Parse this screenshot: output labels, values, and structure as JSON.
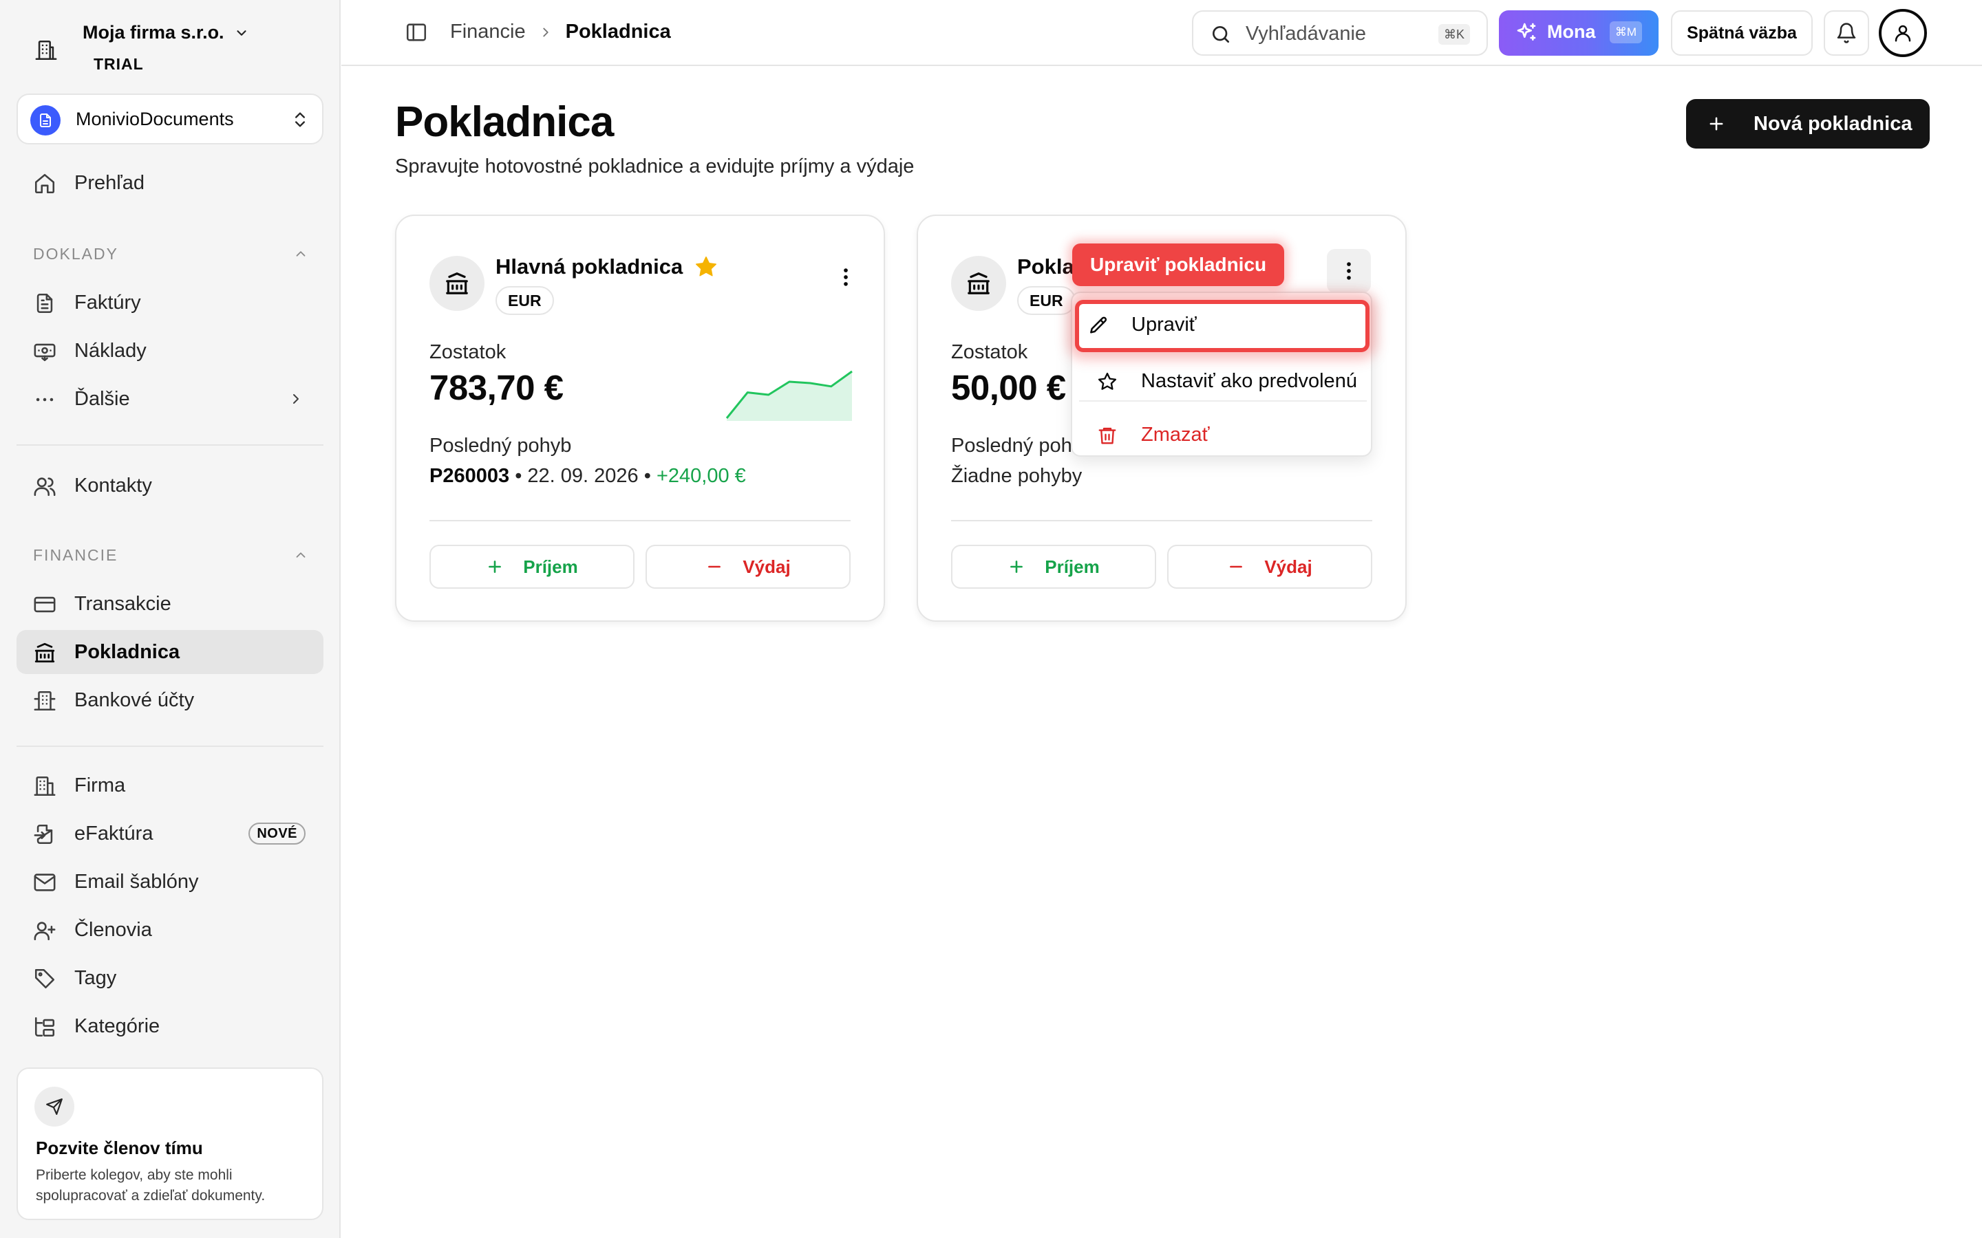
{
  "sidebar": {
    "company_name": "Moja firma s.r.o.",
    "plan": "TRIAL",
    "workspace": "MonivioDocuments",
    "overview": "Prehľad",
    "section_doklady": "DOKLADY",
    "invoices": "Faktúry",
    "expenses": "Náklady",
    "more": "Ďalšie",
    "contacts": "Kontakty",
    "section_financie": "FINANCIE",
    "transactions": "Transakcie",
    "cashbox": "Pokladnica",
    "bank_accounts": "Bankové účty",
    "company": "Firma",
    "einvoice": "eFaktúra",
    "einvoice_badge": "NOVÉ",
    "email_templates": "Email šablóny",
    "members": "Členovia",
    "tags": "Tagy",
    "categories": "Kategórie",
    "invite": {
      "title": "Pozvite členov tímu",
      "text": "Priberte kolegov, aby ste mohli spolupracovať a zdieľať dokumenty."
    }
  },
  "header": {
    "breadcrumb_parent": "Financie",
    "breadcrumb_current": "Pokladnica",
    "search_placeholder": "Vyhľadávanie",
    "search_shortcut": "⌘K",
    "mona_label": "Mona",
    "mona_shortcut": "⌘M",
    "feedback_label": "Spätná väzba"
  },
  "page": {
    "title": "Pokladnica",
    "subtitle": "Spravujte hotovostné pokladnice a evidujte príjmy a výdaje",
    "new_button": "Nová pokladnica"
  },
  "cards": [
    {
      "title": "Hlavná pokladnica",
      "currency": "EUR",
      "is_default": true,
      "balance_label": "Zostatok",
      "balance": "783,70 €",
      "last_move_label": "Posledný pohyb",
      "last_move_doc": "P260003",
      "last_move_date": "22. 09. 2026",
      "last_move_amount": "+240,00 €",
      "income_label": "Príjem",
      "expense_label": "Výdaj",
      "sparkline": [
        0,
        0.55,
        0.5,
        0.78,
        0.75,
        0.68,
        1.0
      ]
    },
    {
      "title": "Pokla",
      "currency": "EUR",
      "balance_label": "Zostatok",
      "balance": "50,00 €",
      "last_move_label": "Posledný poh",
      "last_move_none": "Žiadne pohyby",
      "income_label": "Príjem",
      "expense_label": "Výdaj"
    }
  ],
  "context_menu": {
    "edit": "Upraviť",
    "set_default": "Nastaviť ako predvolenú",
    "delete": "Zmazať"
  },
  "highlight_label": "Upraviť pokladnicu",
  "colors": {
    "accent_red": "#ef4444",
    "income_green": "#16a34a",
    "expense_red": "#dc2626",
    "star": "#f5b301",
    "workspace_blue": "#3b5bfd"
  }
}
